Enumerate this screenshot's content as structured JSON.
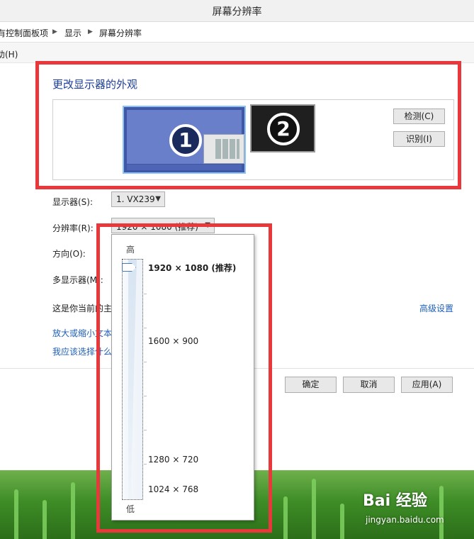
{
  "window": {
    "title": "屏幕分辨率"
  },
  "breadcrumb": {
    "items": [
      "有控制面板项",
      "显示",
      "屏幕分辨率"
    ]
  },
  "menu": {
    "help": "助(H)"
  },
  "section": {
    "heading": "更改显示器的外观",
    "detect_label": "检测(C)",
    "identify_label": "识别(I)",
    "monitor1_number": "1",
    "monitor2_number": "2"
  },
  "form": {
    "display_label": "显示器(S):",
    "display_value": "1. VX239",
    "resolution_label": "分辨率(R):",
    "resolution_value": "1920 × 1080 (推荐)",
    "orientation_label": "方向(O):",
    "multi_display_label": "多显示器(M):",
    "current_label": "这是你当前的主",
    "advanced_link": "高级设置",
    "link_scale": "放大或缩小文本",
    "link_choose": "我应该选择什么"
  },
  "footer": {
    "ok_label": "确定",
    "cancel_label": "取消",
    "apply_label": "应用(A)"
  },
  "dropdown": {
    "high_label": "高",
    "low_label": "低",
    "options": [
      {
        "label": "1920 × 1080 (推荐)",
        "selected": true
      },
      {
        "label": "1600 × 900",
        "selected": false
      },
      {
        "label": "1280 × 720",
        "selected": false
      },
      {
        "label": "1024 × 768",
        "selected": false
      }
    ]
  },
  "watermark": {
    "brand": "Bai 经验",
    "url": "jingyan.baidu.com"
  },
  "colors": {
    "highlight_red": "#e8383b",
    "heading_blue": "#1d3e99",
    "link_blue": "#1d5fb9"
  }
}
